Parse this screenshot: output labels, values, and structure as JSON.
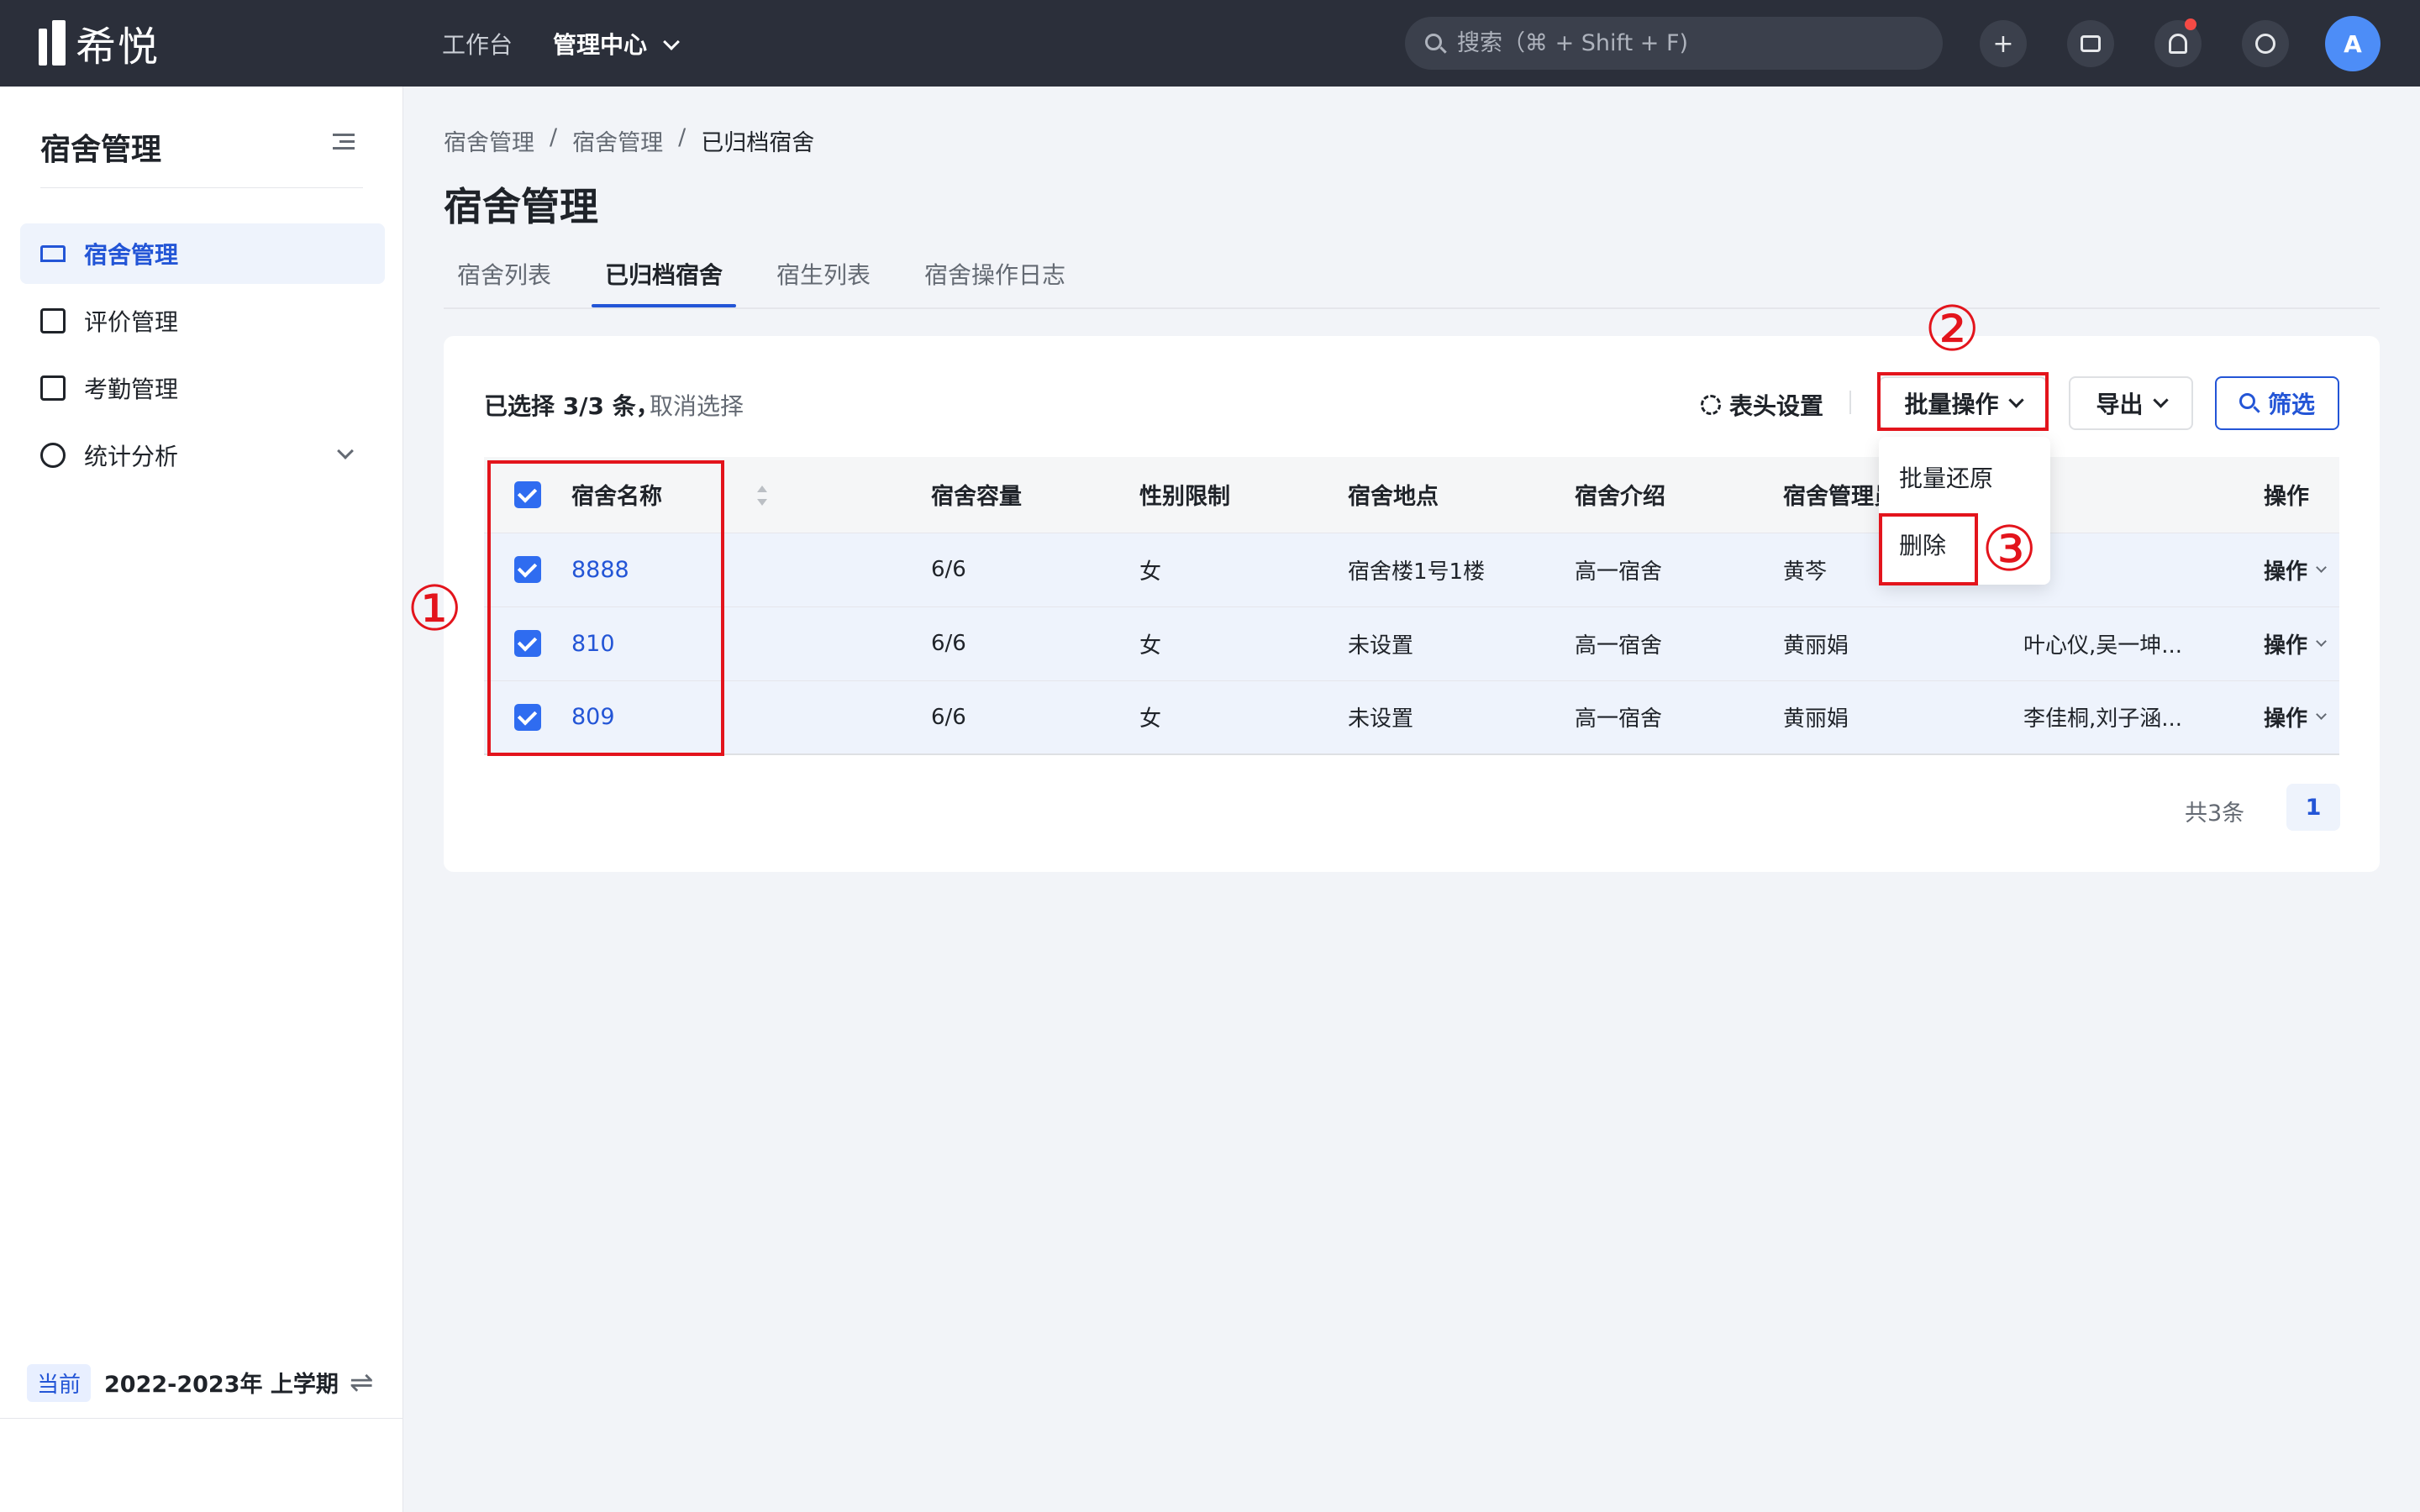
{
  "app": {
    "logo_text": "希悦"
  },
  "topnav": {
    "workbench": "工作台",
    "admin_center": "管理中心"
  },
  "search": {
    "placeholder": "搜索（⌘ + Shift + F)"
  },
  "topbar_icons": [
    "plus-icon",
    "message-icon",
    "bell-icon",
    "help-icon"
  ],
  "user": {
    "avatar_initial": "A"
  },
  "sidebar": {
    "title": "宿舍管理",
    "items": [
      {
        "label": "宿舍管理",
        "icon": "bed-icon",
        "active": true
      },
      {
        "label": "评价管理",
        "icon": "report-icon"
      },
      {
        "label": "考勤管理",
        "icon": "calendar-icon"
      },
      {
        "label": "统计分析",
        "icon": "pie-chart-icon"
      }
    ],
    "term_badge": "当前",
    "term_text": "2022-2023年 上学期"
  },
  "breadcrumb": [
    "宿舍管理",
    "/",
    "宿舍管理",
    "/",
    "已归档宿舍"
  ],
  "page_title": "宿舍管理",
  "tabs": [
    "宿舍列表",
    "已归档宿舍",
    "宿生列表",
    "宿舍操作日志"
  ],
  "toolbar": {
    "selected_text": "已选择 3/3 条，",
    "cancel_select": "取消选择",
    "header_settings": "表头设置",
    "batch_ops": "批量操作",
    "export": "导出",
    "filter": "筛选"
  },
  "table": {
    "headers": [
      "宿舍名称",
      "宿舍容量",
      "性别限制",
      "宿舍地点",
      "宿舍介绍",
      "宿舍管理员",
      "",
      "操作"
    ],
    "rows": [
      {
        "name": "8888",
        "capacity": "6/6",
        "gender": "女",
        "location": "宿舍楼1号1楼",
        "intro": "高一宿舍",
        "manager": "黄芩",
        "residents": "",
        "op": "操作"
      },
      {
        "name": "810",
        "capacity": "6/6",
        "gender": "女",
        "location": "未设置",
        "intro": "高一宿舍",
        "manager": "黄丽娟",
        "residents": "叶心仪,吴一坤...",
        "op": "操作"
      },
      {
        "name": "809",
        "capacity": "6/6",
        "gender": "女",
        "location": "未设置",
        "intro": "高一宿舍",
        "manager": "黄丽娟",
        "residents": "李佳桐,刘子涵...",
        "op": "操作"
      }
    ]
  },
  "dropdown": {
    "items": [
      "批量还原",
      "删除"
    ]
  },
  "pagination": {
    "total": "共3条",
    "current": "1"
  },
  "annotations": {
    "step1": "①",
    "step2": "②",
    "step3": "③"
  },
  "colors": {
    "accent": "#2355d6",
    "topbar": "#2b2f3a",
    "annotation_red": "#e3141c",
    "checkbox": "#2f6cf0"
  }
}
